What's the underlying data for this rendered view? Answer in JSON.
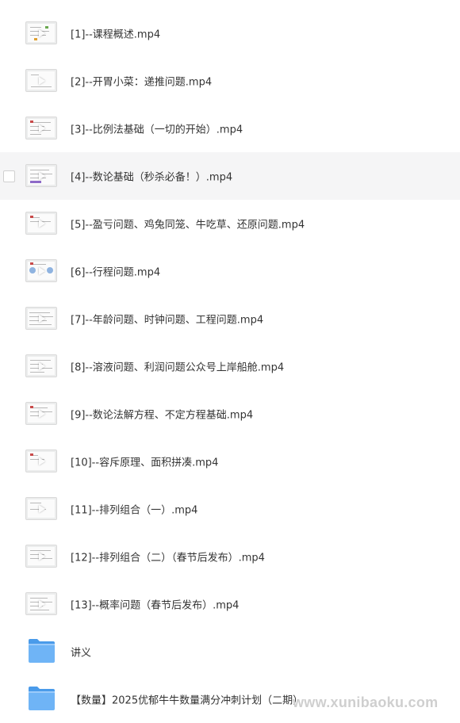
{
  "files": [
    {
      "label": "[1]--课程概述.mp4",
      "type": "video",
      "thumb_icon": "video-thumbnail-icon"
    },
    {
      "label": "[2]--开胃小菜：递推问题.mp4",
      "type": "video",
      "thumb_icon": "video-thumbnail-icon"
    },
    {
      "label": "[3]--比例法基础（一切的开始）.mp4",
      "type": "video",
      "thumb_icon": "video-thumbnail-icon"
    },
    {
      "label": "[4]--数论基础（秒杀必备！）.mp4",
      "type": "video",
      "thumb_icon": "video-thumbnail-icon"
    },
    {
      "label": "[5]--盈亏问题、鸡兔同笼、牛吃草、还原问题.mp4",
      "type": "video",
      "thumb_icon": "video-thumbnail-icon"
    },
    {
      "label": "[6]--行程问题.mp4",
      "type": "video",
      "thumb_icon": "video-thumbnail-icon"
    },
    {
      "label": "[7]--年龄问题、时钟问题、工程问题.mp4",
      "type": "video",
      "thumb_icon": "video-thumbnail-icon"
    },
    {
      "label": "[8]--溶液问题、利润问题公众号上岸船舱.mp4",
      "type": "video",
      "thumb_icon": "video-thumbnail-icon"
    },
    {
      "label": "[9]--数论法解方程、不定方程基础.mp4",
      "type": "video",
      "thumb_icon": "video-thumbnail-icon"
    },
    {
      "label": "[10]--容斥原理、面积拼凑.mp4",
      "type": "video",
      "thumb_icon": "video-thumbnail-icon"
    },
    {
      "label": "[11]--排列组合（一）.mp4",
      "type": "video",
      "thumb_icon": "video-thumbnail-icon"
    },
    {
      "label": "[12]--排列组合（二）（春节后发布）.mp4",
      "type": "video",
      "thumb_icon": "video-thumbnail-icon"
    },
    {
      "label": "[13]--概率问题（春节后发布）.mp4",
      "type": "video",
      "thumb_icon": "video-thumbnail-icon"
    },
    {
      "label": "讲义",
      "type": "folder",
      "thumb_icon": "folder-icon"
    },
    {
      "label": "【数量】2025优郁牛牛数量满分冲刺计划（二期）",
      "type": "folder",
      "thumb_icon": "folder-icon"
    }
  ],
  "hovered_index": 3,
  "watermark": "www.xunibaoku.com",
  "colors": {
    "hover_bg": "#f5f5f6",
    "text": "#333333",
    "folder": "#5aa9f5",
    "watermark": "#cfcfcf"
  }
}
